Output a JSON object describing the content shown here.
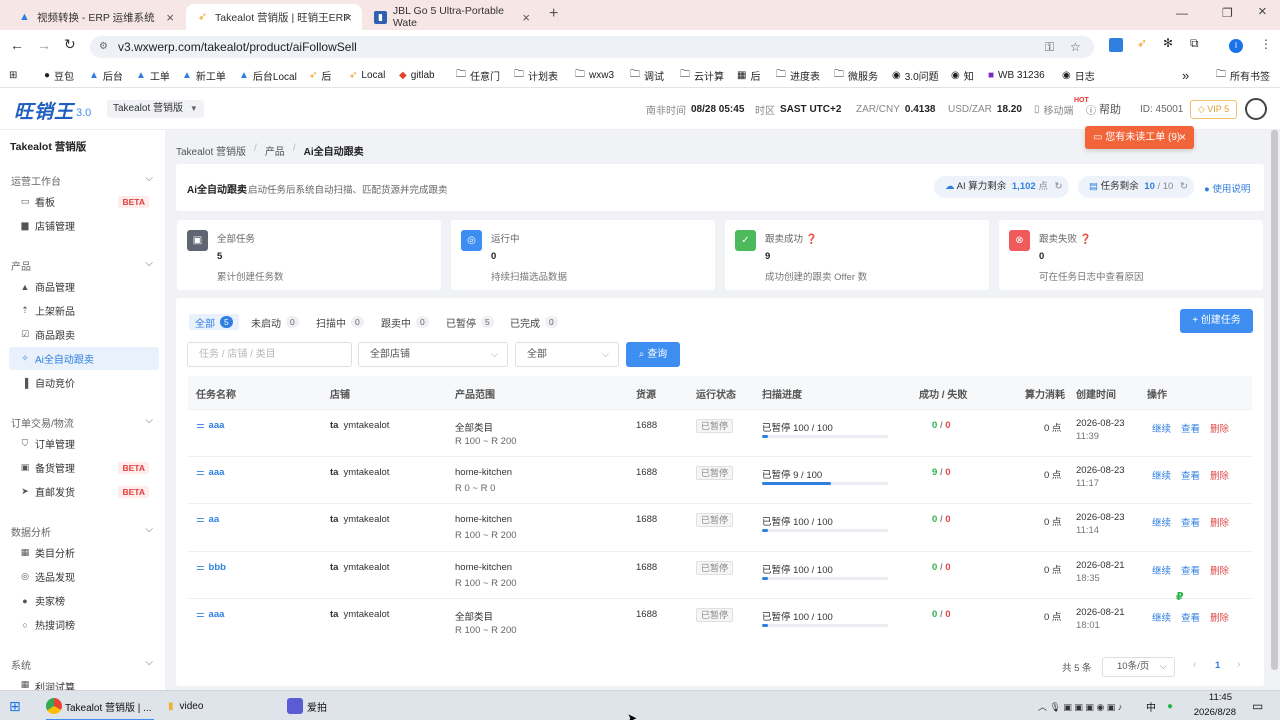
{
  "browser": {
    "tabs": [
      {
        "title": "视频转换 - ERP 运维系统",
        "icon": "mountain-icon"
      },
      {
        "title": "Takealot 营销版 | 旺销王ERP",
        "icon": "arrow-logo-icon"
      },
      {
        "title": "JBL Go 5 Ultra-Portable Wate",
        "icon": "bookmark-tab-icon"
      }
    ],
    "url": "v3.wxwerp.com/takealot/product/aiFollowSell",
    "bookmarks": [
      "豆包",
      "后台",
      "工单",
      "新工单",
      "后台Local",
      "后",
      "Local",
      "gitlab",
      "任意门",
      "计划表",
      "wxw3",
      "调试",
      "云计算",
      "后",
      "进度表",
      "微服务",
      "3.0问题",
      "知",
      "WB 31236",
      "日志"
    ],
    "bookmarks_more": "»",
    "all_bookmarks": "所有书签"
  },
  "header": {
    "logo": "旺销王",
    "logo_version": "3.0",
    "edition": "Takealot 营销版",
    "time_label": "南非时间",
    "time_value": "08/28 05:45",
    "tz_label": "时区",
    "tz_value": "SAST UTC+2",
    "rate1_label": "ZAR/CNY",
    "rate1_value": "0.4138",
    "rate2_label": "USD/ZAR",
    "rate2_value": "18.20",
    "mobile": "移动端",
    "help": "帮助",
    "hot": "HOT",
    "id": "ID: 45001",
    "vip": "VIP 5",
    "notice": "您有未读工单 (9)"
  },
  "sidebar": {
    "title": "Takealot 营销版",
    "groups": [
      {
        "label": "运营工作台",
        "items": [
          {
            "label": "看板",
            "icon": "dashboard-icon",
            "beta": "BETA"
          },
          {
            "label": "店铺管理",
            "icon": "store-icon"
          }
        ]
      },
      {
        "label": "产品",
        "items": [
          {
            "label": "商品管理",
            "icon": "bag-icon"
          },
          {
            "label": "上架新品",
            "icon": "upload-icon"
          },
          {
            "label": "商品跟卖",
            "icon": "check-square-icon"
          },
          {
            "label": "Ai全自动跟卖",
            "icon": "sparkle-icon"
          },
          {
            "label": "自动竞价",
            "icon": "bar-chart-icon"
          }
        ]
      },
      {
        "label": "订单交易/物流",
        "items": [
          {
            "label": "订单管理",
            "icon": "cart-icon"
          },
          {
            "label": "备货管理",
            "icon": "box-icon",
            "beta": "BETA"
          },
          {
            "label": "直邮发货",
            "icon": "send-icon",
            "beta": "BETA"
          }
        ]
      },
      {
        "label": "数据分析",
        "items": [
          {
            "label": "类目分析",
            "icon": "grid-icon"
          },
          {
            "label": "选品发现",
            "icon": "compass-icon"
          },
          {
            "label": "卖家榜",
            "icon": "user-icon"
          },
          {
            "label": "热搜词榜",
            "icon": "search-icon"
          }
        ]
      },
      {
        "label": "系统",
        "items": [
          {
            "label": "利润试算",
            "icon": "calc-icon"
          }
        ]
      }
    ]
  },
  "breadcrumb": [
    "Takealot 营销版",
    "产品",
    "Ai全自动跟卖"
  ],
  "intro": {
    "title": "Ai全自动跟卖",
    "desc": "启动任务后系统自动扫描、匹配货源并完成跟卖",
    "ai_label": "AI 算力剩余",
    "ai_value": "1,102",
    "ai_unit": "点",
    "task_label": "任务剩余",
    "task_value": "10",
    "task_total": "/ 10",
    "guide": "使用说明"
  },
  "stats": [
    {
      "label": "全部任务",
      "value": "5",
      "desc": "累计创建任务数",
      "color": "#5f6672",
      "icon": "briefcase-icon"
    },
    {
      "label": "运行中",
      "value": "0",
      "desc": "持续扫描选品数据",
      "color": "#3d8ef0",
      "icon": "radar-icon"
    },
    {
      "label": "跟卖成功",
      "value": "9",
      "desc": "成功创建的跟卖 Offer 数",
      "color": "#4cba5a",
      "icon": "check-circle-icon",
      "help": true
    },
    {
      "label": "跟卖失败",
      "value": "0",
      "desc": "可在任务日志中查看原因",
      "color": "#ef5b5b",
      "icon": "x-circle-icon",
      "help": true
    }
  ],
  "filter_tabs": [
    {
      "label": "全部",
      "count": "5"
    },
    {
      "label": "未启动",
      "count": "0"
    },
    {
      "label": "扫描中",
      "count": "0"
    },
    {
      "label": "跟卖中",
      "count": "0"
    },
    {
      "label": "已暂停",
      "count": "5"
    },
    {
      "label": "已完成",
      "count": "0"
    }
  ],
  "create_button": "+ 创建任务",
  "search": {
    "placeholder": "任务 / 店铺 / 类目",
    "store_select": "全部店铺",
    "status_select": "全部",
    "query_button": "查询"
  },
  "table": {
    "columns": [
      "任务名称",
      "店铺",
      "产品范围",
      "货源",
      "运行状态",
      "扫描进度",
      "成功 / 失败",
      "算力消耗",
      "创建时间",
      "操作"
    ],
    "rows": [
      {
        "name": "aaa",
        "store": "ymtakealot",
        "scope": "全部类目",
        "price": "R 100 ~ R 200",
        "source": "1688",
        "status": "已暂停",
        "progress_text": "已暂停 100 / 100",
        "progress": 0.05,
        "success": "0",
        "fail": "0",
        "cost": "0 点",
        "date": "2026-08-23",
        "time": "11:39"
      },
      {
        "name": "aaa",
        "store": "ymtakealot",
        "scope": "home-kitchen",
        "price": "R 0 ~ R 0",
        "source": "1688",
        "status": "已暂停",
        "progress_text": "已暂停 9 / 100",
        "progress": 0.55,
        "success": "9",
        "fail": "0",
        "cost": "0 点",
        "date": "2026-08-23",
        "time": "11:17"
      },
      {
        "name": "aa",
        "store": "ymtakealot",
        "scope": "home-kitchen",
        "price": "R 100 ~ R 200",
        "source": "1688",
        "status": "已暂停",
        "progress_text": "已暂停 100 / 100",
        "progress": 0.05,
        "success": "0",
        "fail": "0",
        "cost": "0 点",
        "date": "2026-08-23",
        "time": "11:14"
      },
      {
        "name": "bbb",
        "store": "ymtakealot",
        "scope": "home-kitchen",
        "price": "R 100 ~ R 200",
        "source": "1688",
        "status": "已暂停",
        "progress_text": "已暂停 100 / 100",
        "progress": 0.05,
        "success": "0",
        "fail": "0",
        "cost": "0 点",
        "date": "2026-08-21",
        "time": "18:35"
      },
      {
        "name": "aaa",
        "store": "ymtakealot",
        "scope": "全部类目",
        "price": "R 100 ~ R 200",
        "source": "1688",
        "status": "已暂停",
        "progress_text": "已暂停 100 / 100",
        "progress": 0.05,
        "success": "0",
        "fail": "0",
        "cost": "0 点",
        "date": "2026-08-21",
        "time": "18:01"
      }
    ],
    "actions": [
      "继续",
      "查看",
      "删除"
    ]
  },
  "pagination": {
    "total": "共 5 条",
    "page_size": "10条/页",
    "current": "1"
  },
  "taskbar": {
    "apps": [
      "Takealot 营销版 | ...",
      "video",
      "爱拍"
    ],
    "time": "11:45",
    "date": "2026/8/28",
    "ime": "中"
  }
}
